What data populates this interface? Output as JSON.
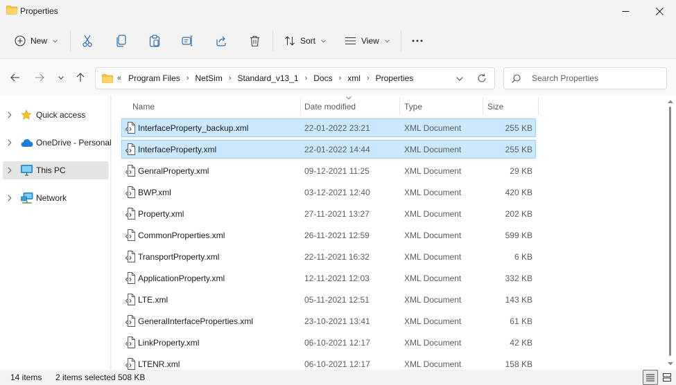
{
  "window": {
    "title": "Properties",
    "minimize_icon": "minimize-icon",
    "maximize_icon": "maximize-icon",
    "close_icon": "close-icon"
  },
  "toolbar": {
    "new_label": "New",
    "sort_label": "Sort",
    "view_label": "View",
    "icons": [
      "cut-icon",
      "copy-icon",
      "paste-icon",
      "rename-icon",
      "share-icon",
      "delete-icon",
      "more-icon"
    ]
  },
  "address": {
    "overflow": "«",
    "crumbs": [
      "Program Files",
      "NetSim",
      "Standard_v13_1",
      "Docs",
      "xml",
      "Properties"
    ],
    "separator": "›"
  },
  "search": {
    "placeholder": "Search Properties"
  },
  "nav": {
    "items": [
      {
        "label": "Quick access",
        "icon": "star-icon"
      },
      {
        "label": "OneDrive - Personal",
        "icon": "cloud-icon"
      },
      {
        "label": "This PC",
        "icon": "monitor-icon",
        "selected": true
      },
      {
        "label": "Network",
        "icon": "network-icon"
      }
    ]
  },
  "columns": {
    "name": "Name",
    "date": "Date modified",
    "type": "Type",
    "size": "Size"
  },
  "files": [
    {
      "name": "InterfaceProperty_backup.xml",
      "date": "22-01-2022 23:21",
      "type": "XML Document",
      "size": "255 KB",
      "selected": true
    },
    {
      "name": "InterfaceProperty.xml",
      "date": "22-01-2022 14:44",
      "type": "XML Document",
      "size": "255 KB",
      "selected": true
    },
    {
      "name": "GenralProperty.xml",
      "date": "09-12-2021 11:25",
      "type": "XML Document",
      "size": "29 KB"
    },
    {
      "name": "BWP.xml",
      "date": "03-12-2021 12:40",
      "type": "XML Document",
      "size": "420 KB"
    },
    {
      "name": "Property.xml",
      "date": "27-11-2021 13:27",
      "type": "XML Document",
      "size": "202 KB"
    },
    {
      "name": "CommonProperties.xml",
      "date": "26-11-2021 12:59",
      "type": "XML Document",
      "size": "599 KB"
    },
    {
      "name": "TransportProperty.xml",
      "date": "22-11-2021 16:32",
      "type": "XML Document",
      "size": "6 KB"
    },
    {
      "name": "ApplicationProperty.xml",
      "date": "12-11-2021 12:03",
      "type": "XML Document",
      "size": "332 KB"
    },
    {
      "name": "LTE.xml",
      "date": "05-11-2021 12:51",
      "type": "XML Document",
      "size": "143 KB"
    },
    {
      "name": "GeneralInterfaceProperties.xml",
      "date": "23-10-2021 13:41",
      "type": "XML Document",
      "size": "61 KB"
    },
    {
      "name": "LinkProperty.xml",
      "date": "06-10-2021 12:17",
      "type": "XML Document",
      "size": "42 KB"
    },
    {
      "name": "LTENR.xml",
      "date": "06-10-2021 12:17",
      "type": "XML Document",
      "size": "158 KB"
    }
  ],
  "status": {
    "count": "14 items",
    "selected": "2 items selected",
    "size": "508 KB"
  },
  "colors": {
    "selection_bg": "#cce8ff",
    "selection_border": "#99d1ff",
    "folder": "#f0c14b",
    "accent": "#0067c0"
  }
}
